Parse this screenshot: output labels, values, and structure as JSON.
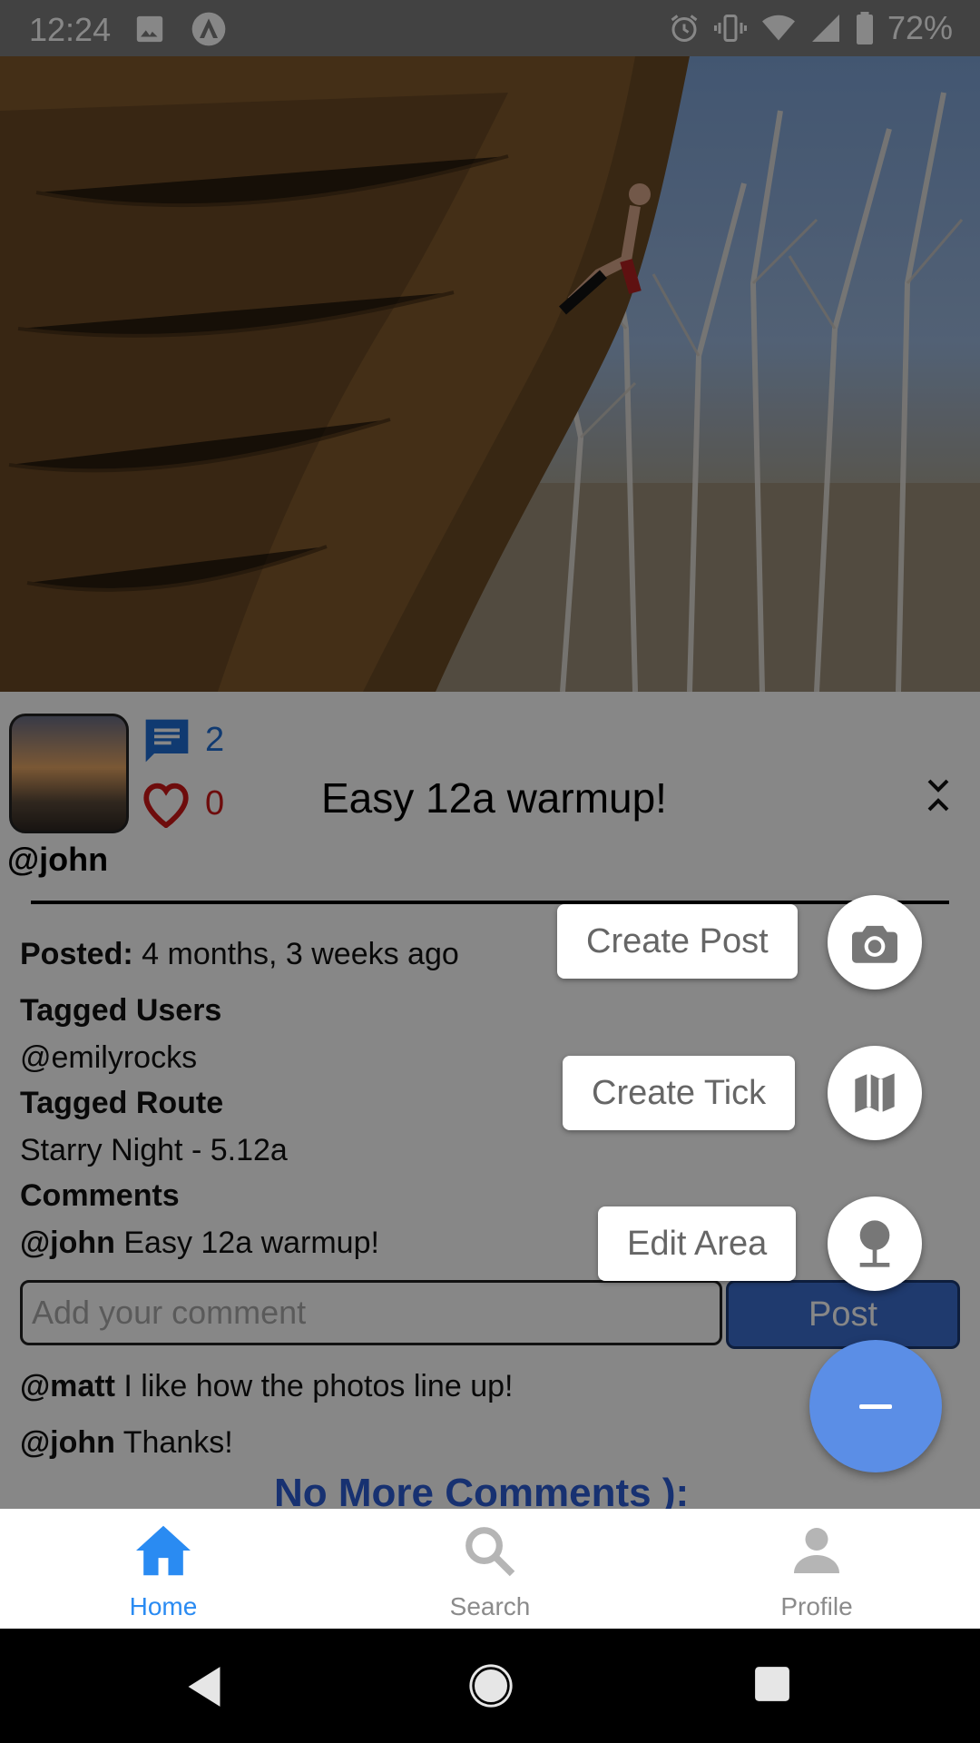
{
  "status_bar": {
    "time": "12:24",
    "battery": "72%"
  },
  "post": {
    "comment_count": "2",
    "like_count": "0",
    "title": "Easy 12a warmup!",
    "username": "@john",
    "posted_label": "Posted:",
    "posted_value": "4 months, 3 weeks ago",
    "tagged_users_label": "Tagged Users",
    "tagged_users": [
      "@emilyrocks"
    ],
    "tagged_route_label": "Tagged Route",
    "tagged_route": "Starry Night - 5.12a",
    "comments_label": "Comments",
    "caption": {
      "user": "@john",
      "text": "Easy 12a warmup!"
    }
  },
  "comment_form": {
    "placeholder": "Add your comment",
    "post_label": "Post"
  },
  "comments": [
    {
      "user": "@matt",
      "text": "I like how the photos line up!"
    },
    {
      "user": "@john",
      "text": "Thanks!"
    }
  ],
  "no_more_comments": "No More Comments ):",
  "fab_menu": {
    "create_post": "Create Post",
    "create_tick": "Create Tick",
    "edit_area": "Edit Area"
  },
  "bottom_nav": {
    "home": "Home",
    "search": "Search",
    "profile": "Profile"
  },
  "colors": {
    "accent": "#2a8bf2",
    "like": "#d01818",
    "fab": "#5b8ee6"
  }
}
